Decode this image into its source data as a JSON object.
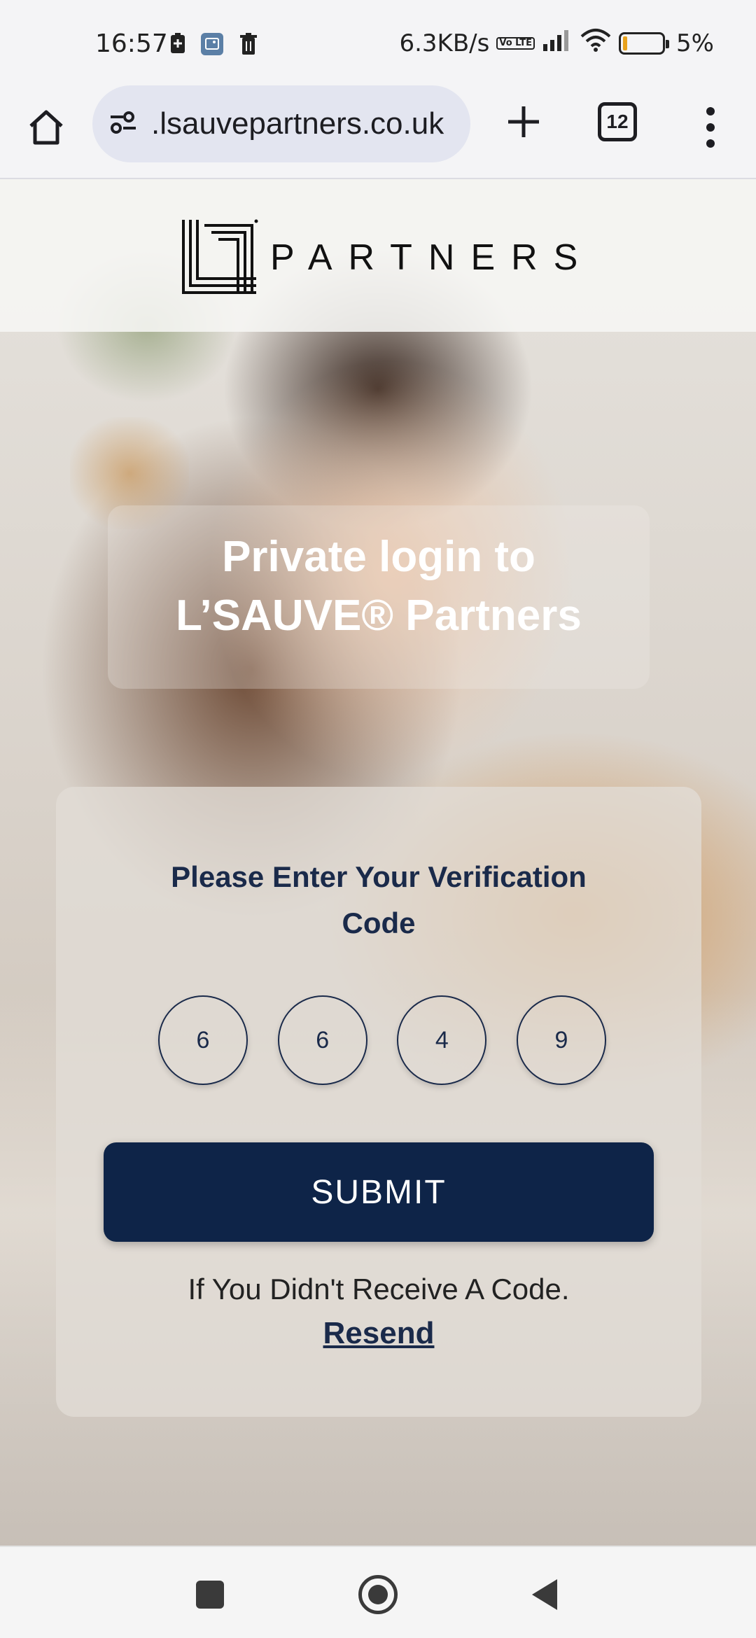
{
  "status_bar": {
    "time": "16:57",
    "network_speed": "6.3KB/s",
    "volte_label": "Vo LTE",
    "battery_percent": "5%",
    "icons": [
      "battery-saver-icon",
      "gallery-icon",
      "trash-icon",
      "volte-icon",
      "signal-icon",
      "wifi-icon",
      "battery-icon"
    ]
  },
  "browser": {
    "url": ".lsauvepartners.co.uk",
    "tab_count": "12",
    "icons": [
      "home-icon",
      "site-settings-icon",
      "plus-icon",
      "tabs-icon",
      "more-vert-icon"
    ]
  },
  "brand": {
    "logo_text": "PARTNERS"
  },
  "hero": {
    "title_line1": "Private login to",
    "title_line2": "L’SAUVE® Partners"
  },
  "verification": {
    "heading": "Please Enter Your Verification Code",
    "digits": [
      "6",
      "6",
      "4",
      "9"
    ],
    "submit_label": "SUBMIT",
    "resend_note": "If You Didn't Receive A Code.",
    "resend_label": "Resend"
  },
  "nav_bar": {
    "icons": [
      "recents-icon",
      "home-circle-icon",
      "back-icon"
    ]
  },
  "colors": {
    "brand_navy": "#0e2448",
    "heading_navy": "#1a2a4a",
    "battery_low": "#e8a21c"
  }
}
